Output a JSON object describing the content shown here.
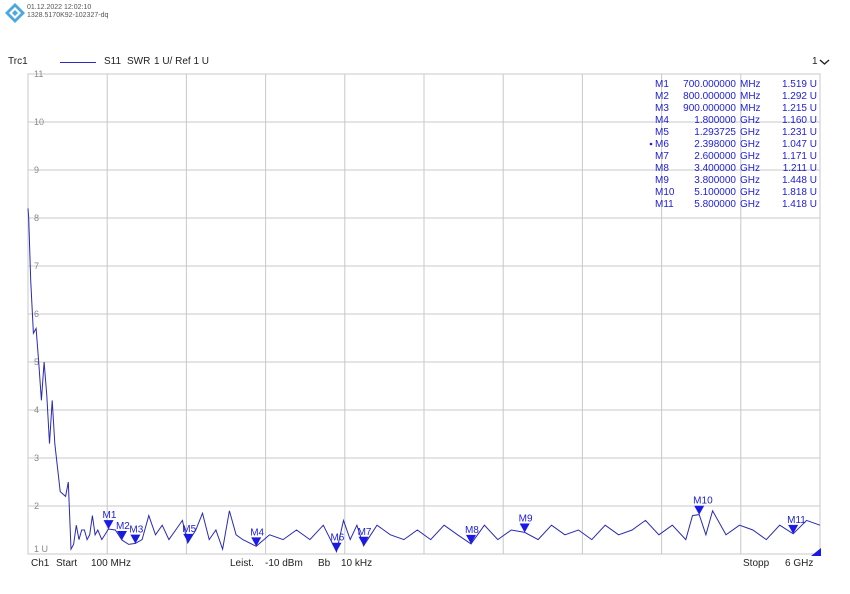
{
  "header": {
    "timestamp": "01.12.2022 12:02:10",
    "device_id": "1328.5170K92-102327-dq"
  },
  "trace": {
    "name": "Trc1",
    "parameter": "S11",
    "format": "SWR",
    "scale": "1 U/ Ref 1 U",
    "channel_indicator": "1",
    "dropdown_icon": "chevron-down-icon"
  },
  "footer": {
    "channel": "Ch1",
    "start_label": "Start",
    "start_value": "100 MHz",
    "power_label": "Leist.",
    "power_value": "-10 dBm",
    "bw_label": "Bb",
    "bw_value": "10 kHz",
    "stop_label": "Stopp",
    "stop_value": "6 GHz"
  },
  "colors": {
    "trace": "#2a2ab4",
    "marker": "#1a1ae6",
    "grid": "#c8c8c8",
    "text": "#2020d8"
  },
  "chart_data": {
    "type": "line",
    "title": "",
    "xlabel": "",
    "ylabel": "",
    "xlim": [
      0.1,
      6.0
    ],
    "ylim": [
      1,
      11
    ],
    "yticks": [
      "11",
      "10",
      "9",
      "8",
      "7",
      "6",
      "5",
      "4",
      "3",
      "2",
      "1 U"
    ],
    "grid": true,
    "series": [
      {
        "x": [
          0.1,
          0.105,
          0.12,
          0.14,
          0.16,
          0.18,
          0.2,
          0.22,
          0.24,
          0.26,
          0.28,
          0.3,
          0.32,
          0.34,
          0.36,
          0.38,
          0.4,
          0.42,
          0.44,
          0.46,
          0.48,
          0.5,
          0.52,
          0.54,
          0.56,
          0.58,
          0.6,
          0.62,
          0.65,
          0.7,
          0.75,
          0.8,
          0.85,
          0.9,
          0.95,
          1.0,
          1.05,
          1.1,
          1.15,
          1.2,
          1.25,
          1.29,
          1.35,
          1.4,
          1.45,
          1.5,
          1.55,
          1.6,
          1.65,
          1.7,
          1.8,
          1.9,
          2.0,
          2.1,
          2.2,
          2.3,
          2.398,
          2.45,
          2.5,
          2.55,
          2.6,
          2.7,
          2.8,
          2.9,
          3.0,
          3.1,
          3.2,
          3.3,
          3.4,
          3.5,
          3.6,
          3.7,
          3.8,
          3.9,
          4.0,
          4.1,
          4.2,
          4.3,
          4.4,
          4.5,
          4.6,
          4.7,
          4.8,
          4.9,
          5.0,
          5.05,
          5.1,
          5.15,
          5.2,
          5.3,
          5.4,
          5.5,
          5.6,
          5.7,
          5.8,
          5.9,
          6.0
        ],
        "y": [
          8.2,
          8.0,
          6.7,
          5.6,
          5.7,
          5.0,
          4.2,
          5.0,
          4.3,
          3.3,
          4.2,
          3.3,
          2.8,
          2.3,
          2.25,
          2.2,
          2.5,
          1.1,
          1.2,
          1.6,
          1.3,
          1.5,
          1.5,
          1.3,
          1.4,
          1.8,
          1.4,
          1.5,
          1.3,
          1.52,
          1.5,
          1.29,
          1.2,
          1.22,
          1.3,
          1.8,
          1.4,
          1.6,
          1.3,
          1.5,
          1.7,
          1.23,
          1.5,
          1.85,
          1.3,
          1.5,
          1.1,
          1.9,
          1.4,
          1.3,
          1.16,
          1.4,
          1.3,
          1.5,
          1.3,
          1.6,
          1.05,
          1.7,
          1.3,
          1.6,
          1.17,
          1.6,
          1.4,
          1.3,
          1.5,
          1.3,
          1.6,
          1.4,
          1.21,
          1.6,
          1.3,
          1.5,
          1.45,
          1.3,
          1.6,
          1.4,
          1.5,
          1.3,
          1.6,
          1.4,
          1.5,
          1.7,
          1.4,
          1.6,
          1.3,
          1.8,
          1.82,
          1.4,
          1.9,
          1.4,
          1.6,
          1.5,
          1.3,
          1.6,
          1.42,
          1.7,
          1.6
        ]
      }
    ],
    "markers": [
      {
        "name": "M1",
        "freq": "700.000000",
        "unit": "MHz",
        "value": "1.519 U",
        "x": 0.7,
        "y": 1.519
      },
      {
        "name": "M2",
        "freq": "800.000000",
        "unit": "MHz",
        "value": "1.292 U",
        "x": 0.8,
        "y": 1.292
      },
      {
        "name": "M3",
        "freq": "900.000000",
        "unit": "MHz",
        "value": "1.215 U",
        "x": 0.9,
        "y": 1.215
      },
      {
        "name": "M4",
        "freq": "1.800000",
        "unit": "GHz",
        "value": "1.160 U",
        "x": 1.8,
        "y": 1.16
      },
      {
        "name": "M5",
        "freq": "1.293725",
        "unit": "GHz",
        "value": "1.231 U",
        "x": 1.293725,
        "y": 1.231
      },
      {
        "name": "M6",
        "freq": "2.398000",
        "unit": "GHz",
        "value": "1.047 U",
        "x": 2.398,
        "y": 1.047,
        "active": true
      },
      {
        "name": "M7",
        "freq": "2.600000",
        "unit": "GHz",
        "value": "1.171 U",
        "x": 2.6,
        "y": 1.171
      },
      {
        "name": "M8",
        "freq": "3.400000",
        "unit": "GHz",
        "value": "1.211 U",
        "x": 3.4,
        "y": 1.211
      },
      {
        "name": "M9",
        "freq": "3.800000",
        "unit": "GHz",
        "value": "1.448 U",
        "x": 3.8,
        "y": 1.448
      },
      {
        "name": "M10",
        "freq": "5.100000",
        "unit": "GHz",
        "value": "1.818 U",
        "x": 5.1,
        "y": 1.818
      },
      {
        "name": "M11",
        "freq": "5.800000",
        "unit": "GHz",
        "value": "1.418 U",
        "x": 5.8,
        "y": 1.418
      }
    ]
  }
}
